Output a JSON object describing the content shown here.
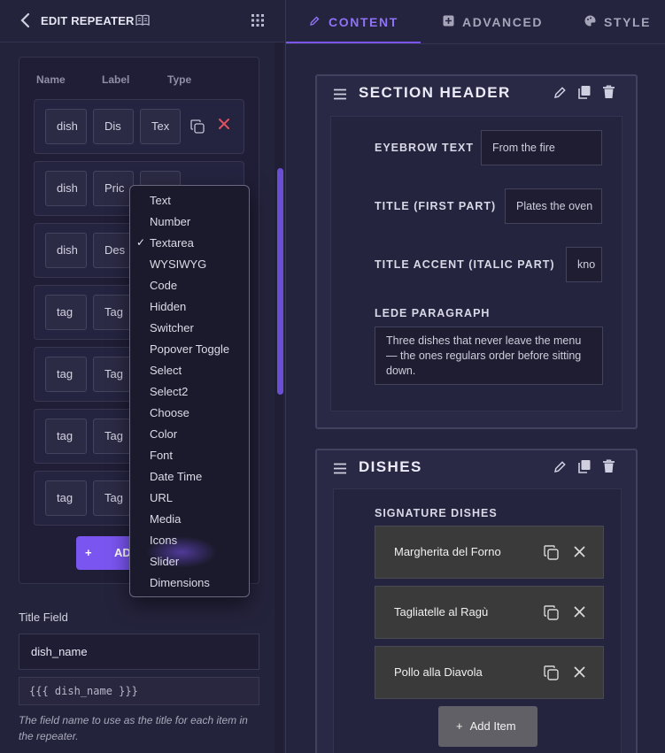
{
  "left_panel": {
    "back_icon": "chevron-left-icon",
    "title": "EDIT REPEATER",
    "book_icon": "book-open-icon",
    "grid_icon": "grid-dots-icon",
    "columns": [
      "Name",
      "Label",
      "Type"
    ],
    "rows": [
      {
        "name": "dish",
        "label": "Dis",
        "type": "Tex"
      },
      {
        "name": "dish",
        "label": "Pric",
        "type": ""
      },
      {
        "name": "dish",
        "label": "Des",
        "type": ""
      },
      {
        "name": "tag",
        "label": "Tag",
        "type": ""
      },
      {
        "name": "tag",
        "label": "Tag",
        "type": ""
      },
      {
        "name": "tag",
        "label": "Tag",
        "type": ""
      },
      {
        "name": "tag",
        "label": "Tag",
        "type": ""
      }
    ],
    "add_button_label": "AD",
    "type_dropdown": {
      "selected": "Textarea",
      "options": [
        "Text",
        "Number",
        "Textarea",
        "WYSIWYG",
        "Code",
        "Hidden",
        "Switcher",
        "Popover Toggle",
        "Select",
        "Select2",
        "Choose",
        "Color",
        "Font",
        "Date Time",
        "URL",
        "Media",
        "Icons",
        "Slider",
        "Dimensions"
      ]
    },
    "title_field": {
      "label": "Title Field",
      "value": "dish_name",
      "template": "{{{ dish_name }}}",
      "help": "The field name to use as the title for each item in the repeater."
    },
    "accent_color": "#7b55f0",
    "delete_color": "#e0525f"
  },
  "right_panel": {
    "tabs": [
      {
        "label": "CONTENT",
        "icon": "pencil-icon",
        "active": true
      },
      {
        "label": "ADVANCED",
        "icon": "grid-plus-icon",
        "active": false
      },
      {
        "label": "STYLE",
        "icon": "palette-icon",
        "active": false
      }
    ],
    "section_header": {
      "title": "SECTION HEADER",
      "fields": {
        "eyebrow_label": "EYEBROW TEXT",
        "eyebrow_value": "From the fire",
        "title_first_label": "TITLE (FIRST PART)",
        "title_first_value": "Plates the oven",
        "title_accent_label": "TITLE ACCENT (ITALIC PART)",
        "title_accent_value": "kno",
        "lede_label": "LEDE PARAGRAPH",
        "lede_value": "Three dishes that never leave the menu — the ones regulars order before sitting down."
      }
    },
    "dishes_section": {
      "title": "DISHES",
      "repeater_label": "SIGNATURE DISHES",
      "items": [
        "Margherita del Forno",
        "Tagliatelle al Ragù",
        "Pollo alla Diavola"
      ],
      "add_item_label": "Add Item"
    }
  }
}
